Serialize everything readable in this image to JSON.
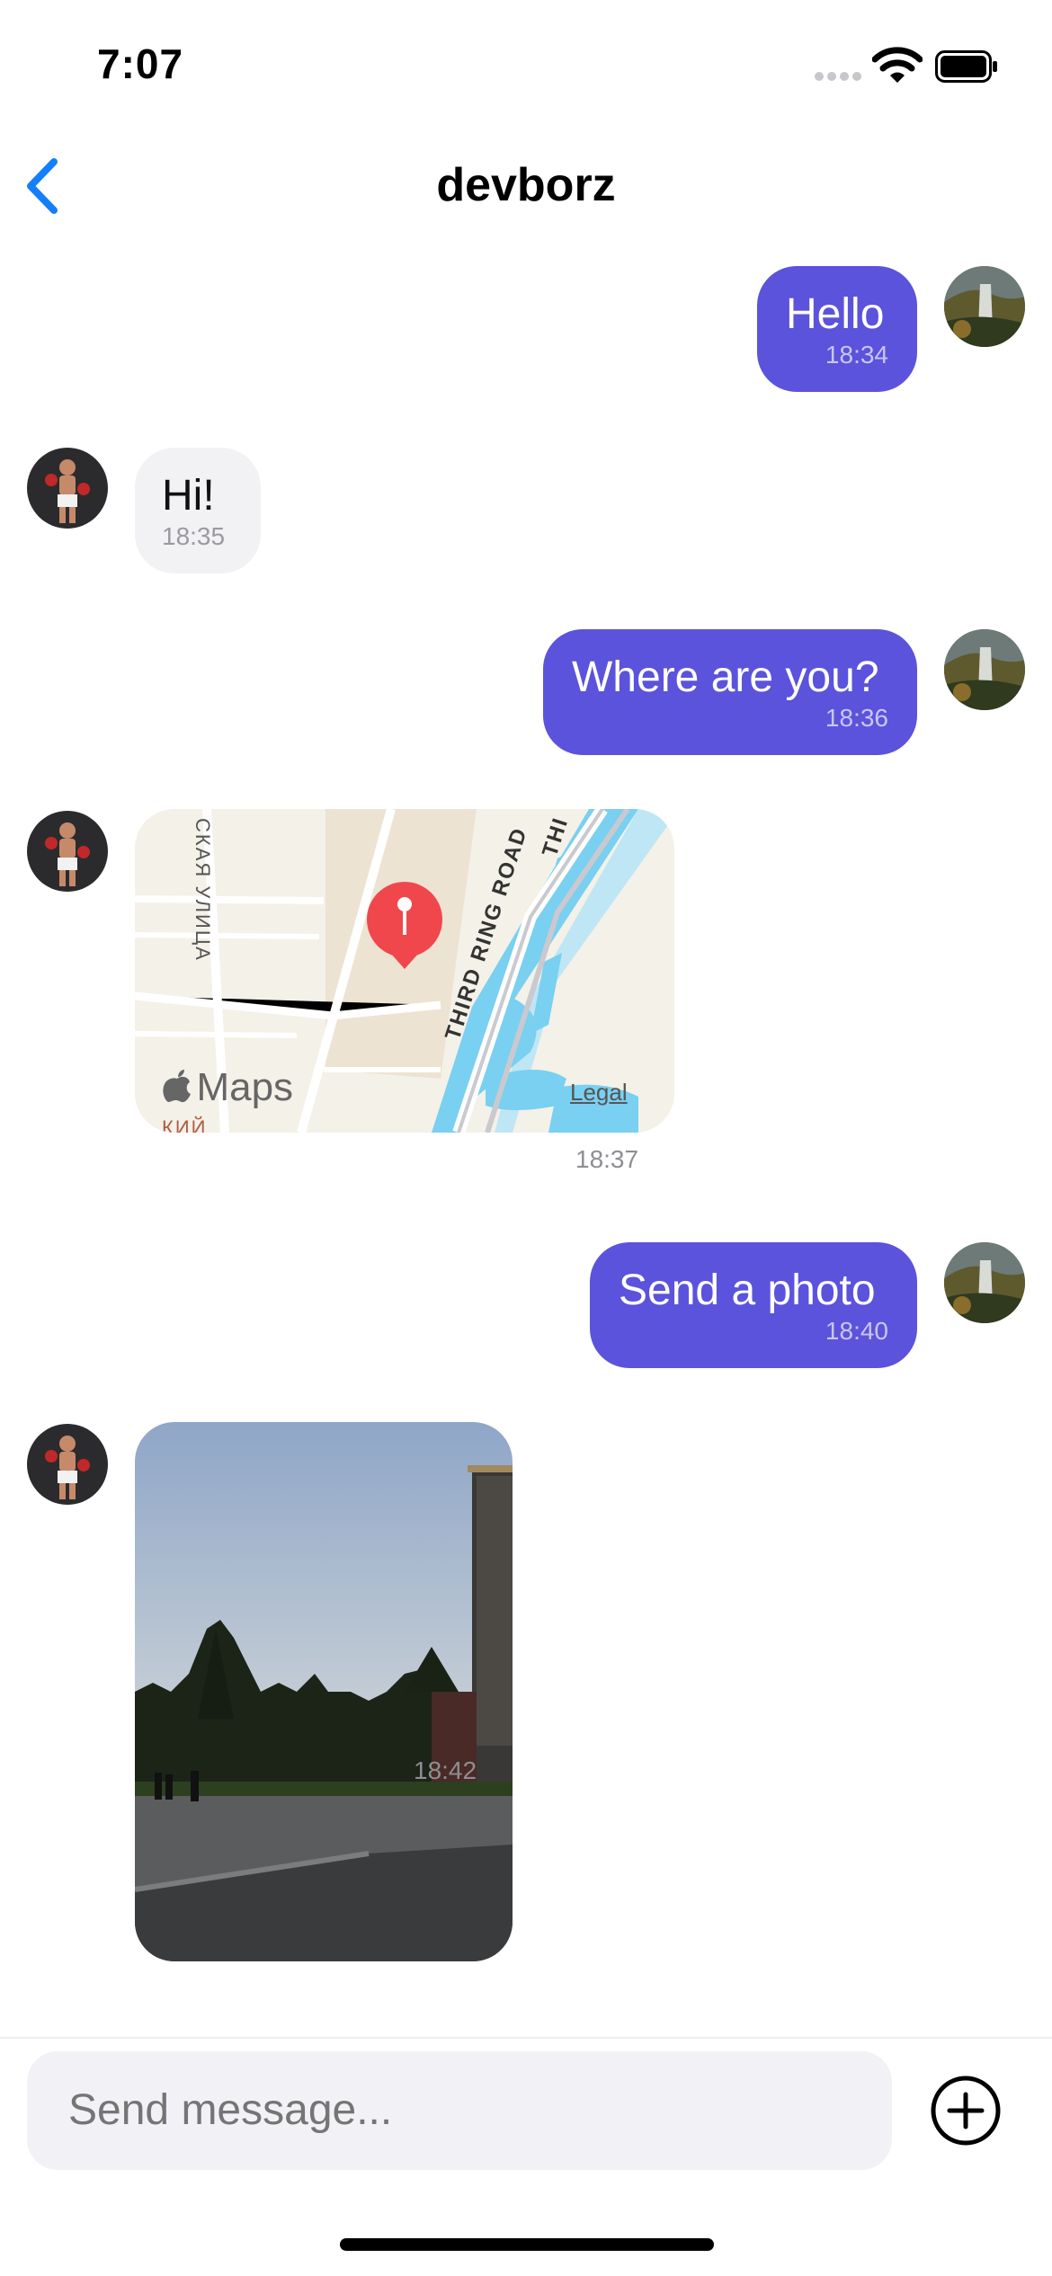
{
  "status_bar": {
    "time": "7:07"
  },
  "header": {
    "title": "devborz"
  },
  "messages": [
    {
      "text": "Hello",
      "time": "18:34"
    },
    {
      "text": "Hi!",
      "time": "18:35"
    },
    {
      "text": "Where are you?",
      "time": "18:36"
    },
    {
      "time": "18:37"
    },
    {
      "text": "Send a photo",
      "time": "18:40"
    },
    {
      "time": "18:42"
    }
  ],
  "map": {
    "street_left": "СКАЯ УЛИЦА",
    "road_label": "THIRD RING ROAD",
    "road_label_top": "THI",
    "brand": "Maps",
    "legal": "Legal",
    "partial_label": "КИЙ"
  },
  "input": {
    "placeholder": "Send message..."
  },
  "colors": {
    "accent": "#5b53dc",
    "incoming": "#f2f2f5",
    "back": "#147efb",
    "pin": "#f0474c"
  }
}
